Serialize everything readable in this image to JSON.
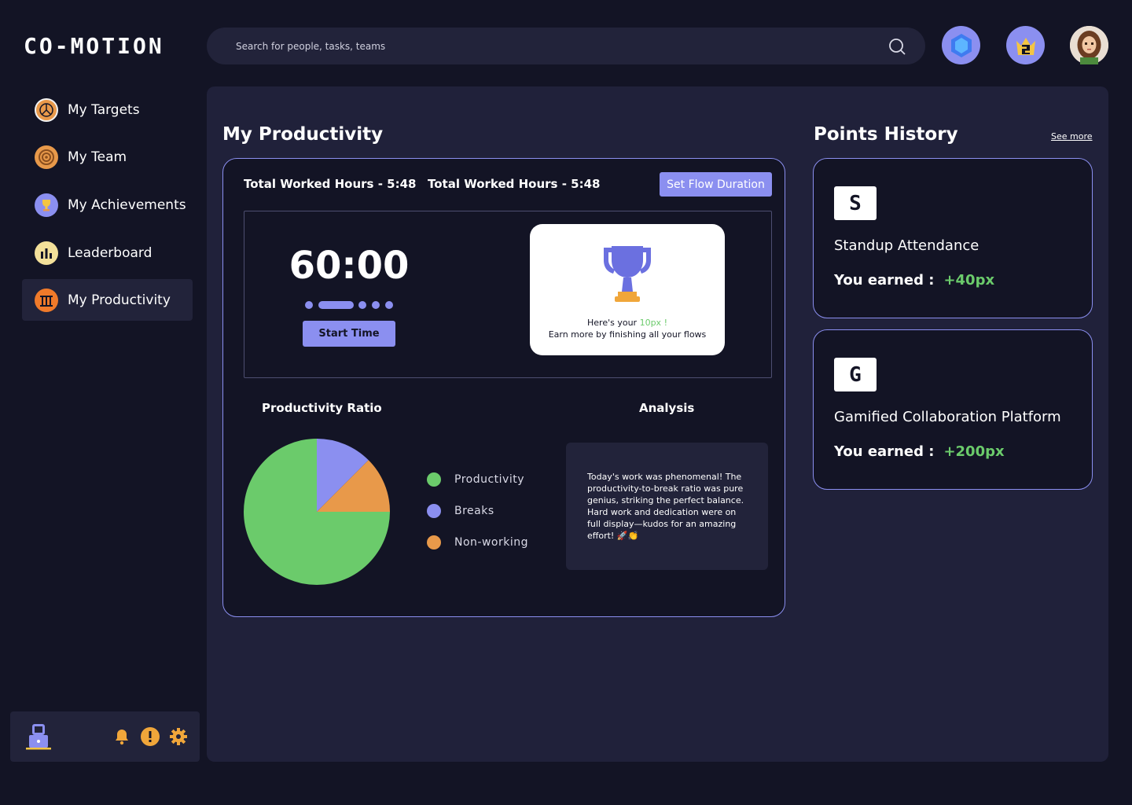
{
  "app": {
    "logo": "CO-MOTION"
  },
  "search": {
    "placeholder": "Search for people, tasks, teams"
  },
  "sidebar": {
    "items": [
      {
        "label": "My Targets",
        "icon": "target-icon"
      },
      {
        "label": "My Team",
        "icon": "team-icon"
      },
      {
        "label": "My Achievements",
        "icon": "trophy-icon"
      },
      {
        "label": "Leaderboard",
        "icon": "leaderboard-icon"
      },
      {
        "label": "My Productivity",
        "icon": "productivity-icon",
        "active": true
      }
    ]
  },
  "productivity": {
    "title": "My Productivity",
    "hours_1": "Total Worked Hours - 5:48",
    "hours_2": "Total Worked Hours - 5:48",
    "flow_button": "Set Flow Duration",
    "timer": "60:00",
    "start_button": "Start Time",
    "reward_prefix": "Here's your ",
    "reward_points": "10px !",
    "reward_line2": "Earn more by finishing all your flows",
    "ratio_title": "Productivity Ratio",
    "analysis_title": "Analysis",
    "analysis_text": "Today's work was phenomenal! The productivity-to-break ratio was pure genius, striking the perfect balance. Hard work and dedication were on full display—kudos for an amazing effort! 🚀👏"
  },
  "chart_data": {
    "type": "pie",
    "categories": [
      "Productivity",
      "Breaks",
      "Non-working"
    ],
    "values": [
      75,
      12.5,
      12.5
    ],
    "colors": [
      "#6bcb6b",
      "#8b8ff0",
      "#e8994a"
    ],
    "legend_position": "right"
  },
  "points": {
    "title": "Points History",
    "see_more": "See more",
    "cards": [
      {
        "icon_letter": "S",
        "title": "Standup Attendance",
        "earned_label": "You earned :",
        "earned_value": "+40px"
      },
      {
        "icon_letter": "G",
        "title": "Gamified Collaboration Platform",
        "earned_label": "You earned :",
        "earned_value": "+200px"
      }
    ]
  },
  "colors": {
    "accent": "#8b8ff0",
    "green": "#6bcb6b",
    "orange": "#e8994a",
    "bg": "#131425",
    "panel": "#20213a"
  }
}
